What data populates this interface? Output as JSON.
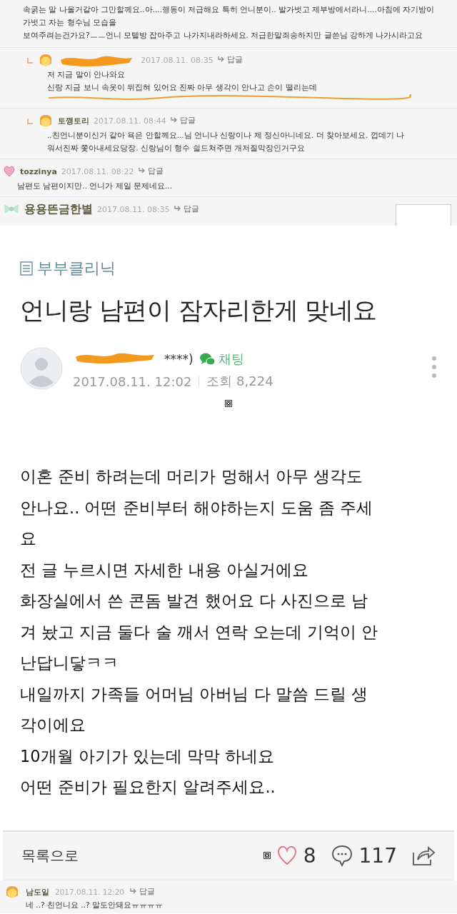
{
  "comments": [
    {
      "kind": "continuation",
      "lines": [
        "속굵는 말 나올거같아 그만할께요..아....행동이 저급해요 특히 언니분이.. 발가벗고 제부방에서라니....아침에 자기방이",
        "가벗고 자는 형수님 모습을",
        "보여주려는건가요?ㅡㅡ언니 모텔방 잡아주고 나가지내라하세요. 저급한말죄송하지만 글쓴님 강하게 나가시라고요"
      ]
    },
    {
      "kind": "reply",
      "redacted": true,
      "underlined": true,
      "time": "2017.08.11. 08:35",
      "reply_link": "답글",
      "lines": [
        "저 지금 말이 안나와요",
        "신랑 지금 보니 속옷이 뒤집혀 있어요 진짜 아무 생각이 안나고 손이 떨리는데"
      ]
    },
    {
      "kind": "reply",
      "redacted": false,
      "underlined": false,
      "author": "토깽토리",
      "time": "2017.08.11. 08:44",
      "reply_link": "답글",
      "lines": [
        "..친언니분이신거 같아 욕은 안할께요...님 언니나 신랑이나 제 정신아니네요. 더 찾아보세요. 껍데기 나",
        "워서진짜 쫓아내세요당장. 신랑님이 형수 쉴드쳐주면 개저질막장인거구요"
      ]
    },
    {
      "kind": "comment",
      "redacted": false,
      "underlined": false,
      "author": "tozzinya",
      "time": "2017.08.11. 08:22",
      "reply_link": "답글",
      "lines": [
        "남편도 남편이지만.. 언니가 제일 문제네요..."
      ]
    },
    {
      "kind": "comment",
      "redacted": false,
      "underlined": false,
      "author": "용용뜬금한별",
      "time": "2017.08.11. 08:35",
      "reply_link": "답글"
    }
  ],
  "article": {
    "category": "부부클리닉",
    "title": "언니랑 남편이 잠자리한게 맞네요",
    "author": "****)",
    "author_redacted": true,
    "chat": "채팅",
    "date": "2017.08.11. 12:02",
    "views": "조회 8,224",
    "body": [
      "이혼 준비 하려는데 머리가 멍해서 아무 생각도",
      "안나요.. 어떤 준비부터 해야하는지 도움 좀 주세",
      "요",
      "전 글 누르시면 자세한 내용 아실거에요",
      "화장실에서 쓴 콘돔 발견 했어요 다 사진으로 남",
      "겨 놨고 지금 둘다 술 깨서 연락 오는데 기억이 안",
      "난답니닿ㅋㅋ",
      "내일까지 가족들 어머님 아버님 다 말씀 드릴 생",
      "각이에요",
      "10개월 아기가 있는데 막막 하네요",
      "어떤 준비가 필요한지 알려주세요.."
    ]
  },
  "footer": {
    "back": "목록으로",
    "likes": "8",
    "comments": "117"
  },
  "bottom_comment": {
    "author": "남도일",
    "time": "2017.08.11. 12:20",
    "reply_link": "답글",
    "text": "네 ..? 친언니요 ..? 말도안돼요ㅠㅠㅠㅠ"
  }
}
